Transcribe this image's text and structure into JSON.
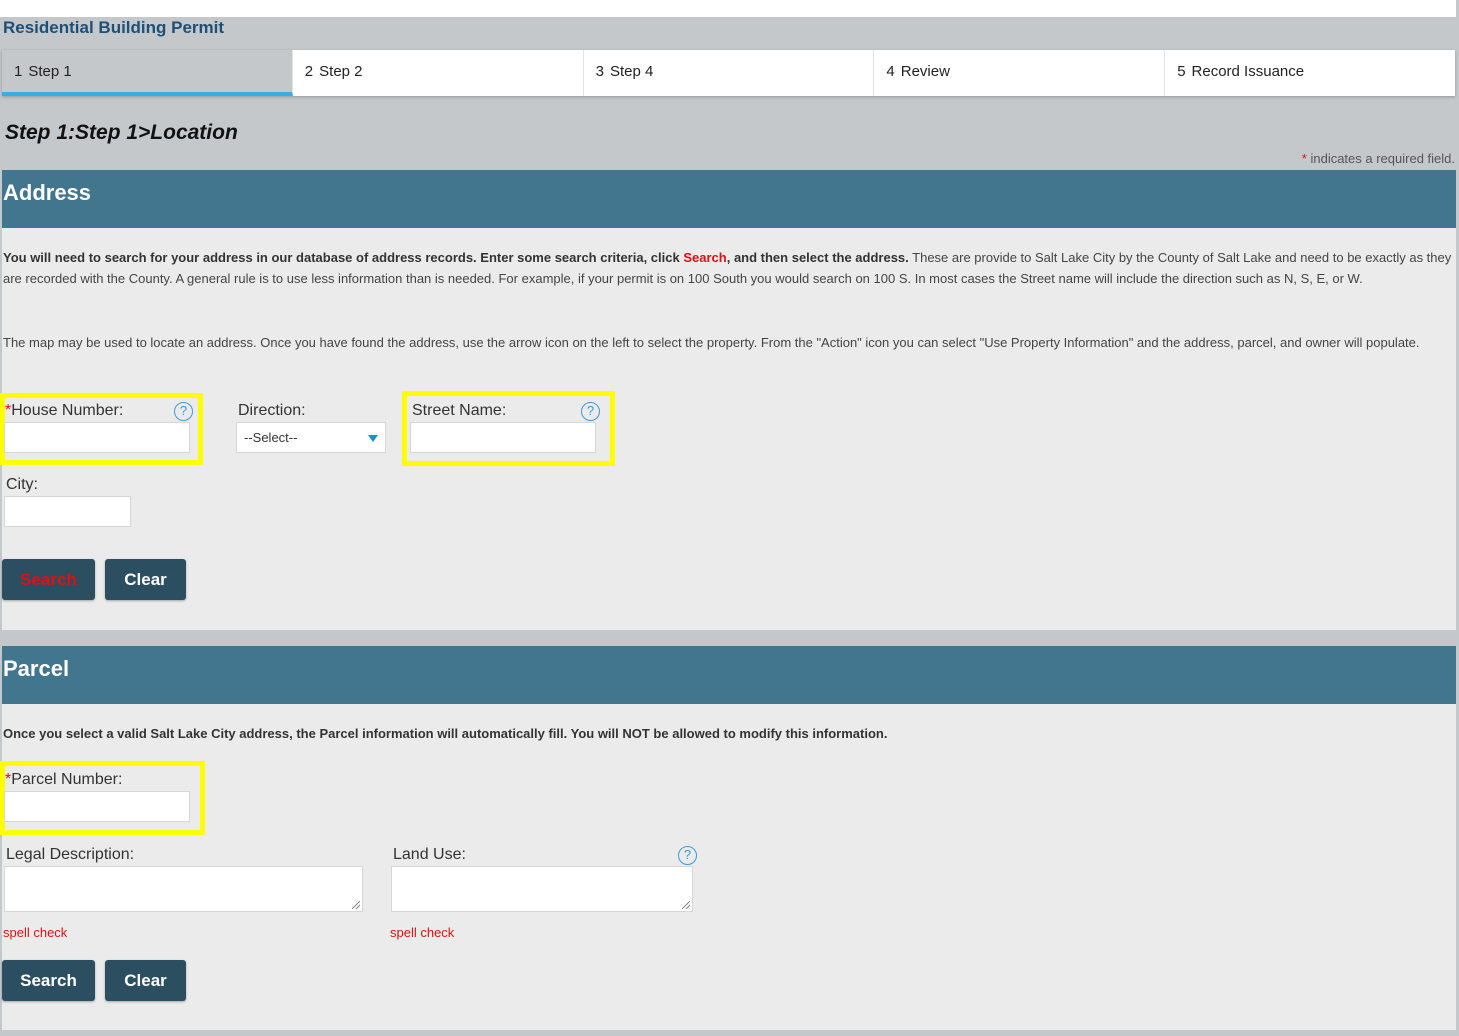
{
  "header": {
    "permit_title": "Residential Building Permit"
  },
  "steps": [
    {
      "num": "1",
      "label": "Step 1"
    },
    {
      "num": "2",
      "label": "Step 2"
    },
    {
      "num": "3",
      "label": "Step 4"
    },
    {
      "num": "4",
      "label": "Review"
    },
    {
      "num": "5",
      "label": "Record Issuance"
    }
  ],
  "page_heading": "Step 1:Step 1>Location",
  "required_note": {
    "star": "*",
    "text": "indicates a required field."
  },
  "address": {
    "title": "Address",
    "para1_bold_a": "You will need to search for your address in our database of address records. Enter some search criteria, click ",
    "para1_link": "Search",
    "para1_bold_b": ", and then select the address.",
    "para1_rest": " These are provide to Salt Lake City by the County of Salt Lake and need to be exactly as they are recorded with the County. A general rule is to use less information than is needed. For example, if your permit is on 100 South you would search on 100 S. In most cases the Street name will include the direction such as N, S, E, or W.",
    "para2": "The map may be used to locate an address. Once you have found the address, use the arrow icon on the left to select the property. From the \"Action\" icon you can select \"Use Property Information\" and the address, parcel, and owner will populate.",
    "house_number_label": "House Number:",
    "house_number_value": "",
    "direction_label": "Direction:",
    "direction_selected": "--Select--",
    "street_name_label": "Street Name:",
    "street_name_value": "",
    "city_label": "City:",
    "city_value": "",
    "search_button": "Search",
    "clear_button": "Clear"
  },
  "parcel": {
    "title": "Parcel",
    "para": "Once you select a valid Salt Lake City address, the Parcel information will automatically fill. You will NOT be allowed to modify this information.",
    "parcel_number_label": "Parcel Number:",
    "parcel_number_value": "",
    "legal_description_label": "Legal Description:",
    "land_use_label": "Land Use:",
    "spell_check": "spell check",
    "search_button": "Search",
    "clear_button": "Clear"
  },
  "icons": {
    "help": "help-circle-icon",
    "dropdown": "chevron-down-icon"
  },
  "colors": {
    "section_header": "#42758e",
    "button": "#2b4e61",
    "highlight": "#ffff00",
    "link_red": "#e01010",
    "active_tab_underline": "#3aaee0",
    "title_blue": "#1d4f77"
  }
}
